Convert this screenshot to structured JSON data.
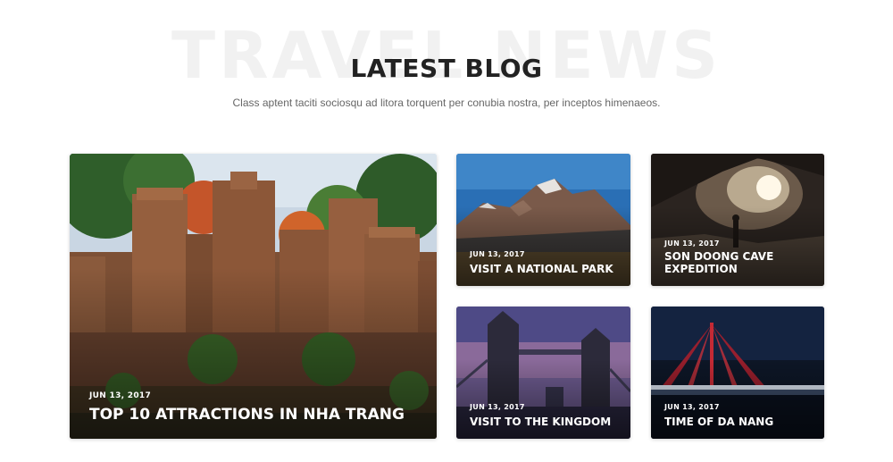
{
  "header": {
    "watermark": "TRAVEL NEWS",
    "title": "LATEST BLOG",
    "subtitle": "Class aptent taciti sociosqu ad litora torquent per conubia nostra, per inceptos himenaeos."
  },
  "posts": [
    {
      "date": "JUN 13, 2017",
      "title": "TOP 10 ATTRACTIONS IN NHA TRANG",
      "image": "temple-ruins"
    },
    {
      "date": "JUN 13, 2017",
      "title": "VISIT A NATIONAL PARK",
      "image": "mountain"
    },
    {
      "date": "JUN 13, 2017",
      "title": "SON DOONG CAVE EXPEDITION",
      "image": "cave"
    },
    {
      "date": "JUN 13, 2017",
      "title": "VISIT TO THE KINGDOM",
      "image": "tower-bridge"
    },
    {
      "date": "JUN 13, 2017",
      "title": "TIME OF DA NANG",
      "image": "night-bridge"
    }
  ]
}
